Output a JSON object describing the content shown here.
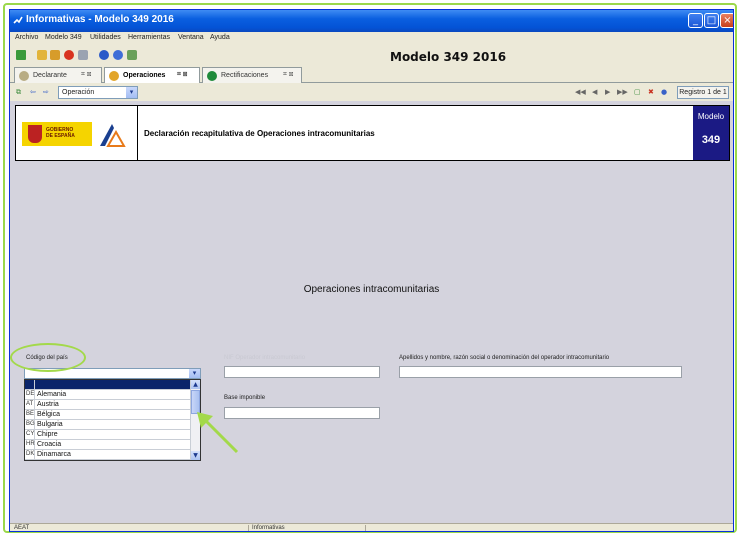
{
  "window": {
    "title": "Informativas - Modelo 349 2016"
  },
  "menu": [
    "Archivo",
    "Modelo 349",
    "Utilidades",
    "Herramientas",
    "Ventana",
    "Ayuda"
  ],
  "toolbar": {
    "model_title": "Modelo 349 2016"
  },
  "tabs": [
    {
      "label": "Declarante"
    },
    {
      "label": "Operaciones"
    },
    {
      "label": "Rectificaciones"
    }
  ],
  "navbar": {
    "selected_view": "Operación",
    "record": "Registro 1 de 1"
  },
  "header": {
    "gobierno_text": "GOBIERNO\nDE ESPAÑA",
    "title": "Declaración recapitulativa de Operaciones intracomunitarias",
    "modelo_label": "Modelo",
    "modelo_number": "349"
  },
  "form": {
    "section_title": "Operaciones intracomunitarias",
    "codigo_pais_label": "Código del país",
    "nif_label": "NIF Operador intracomunitario",
    "nombre_label": "Apellidos y nombre, razón social o denominación del operador intracomunitario",
    "base_label": "Base imponible",
    "pais_value": "",
    "countries": [
      {
        "code": "",
        "name": ""
      },
      {
        "code": "DE",
        "name": "Alemania"
      },
      {
        "code": "AT",
        "name": "Austria"
      },
      {
        "code": "BE",
        "name": "Bélgica"
      },
      {
        "code": "BG",
        "name": "Bulgaria"
      },
      {
        "code": "CY",
        "name": "Chipre"
      },
      {
        "code": "HR",
        "name": "Croacia"
      },
      {
        "code": "DK",
        "name": "Dinamarca"
      }
    ]
  },
  "status": {
    "left": "AEAT",
    "center": "Informativas"
  },
  "colors": {
    "accent": "#0a5fe0",
    "annotation": "#a3d94a",
    "modelo_badge": "#1b1a84"
  }
}
